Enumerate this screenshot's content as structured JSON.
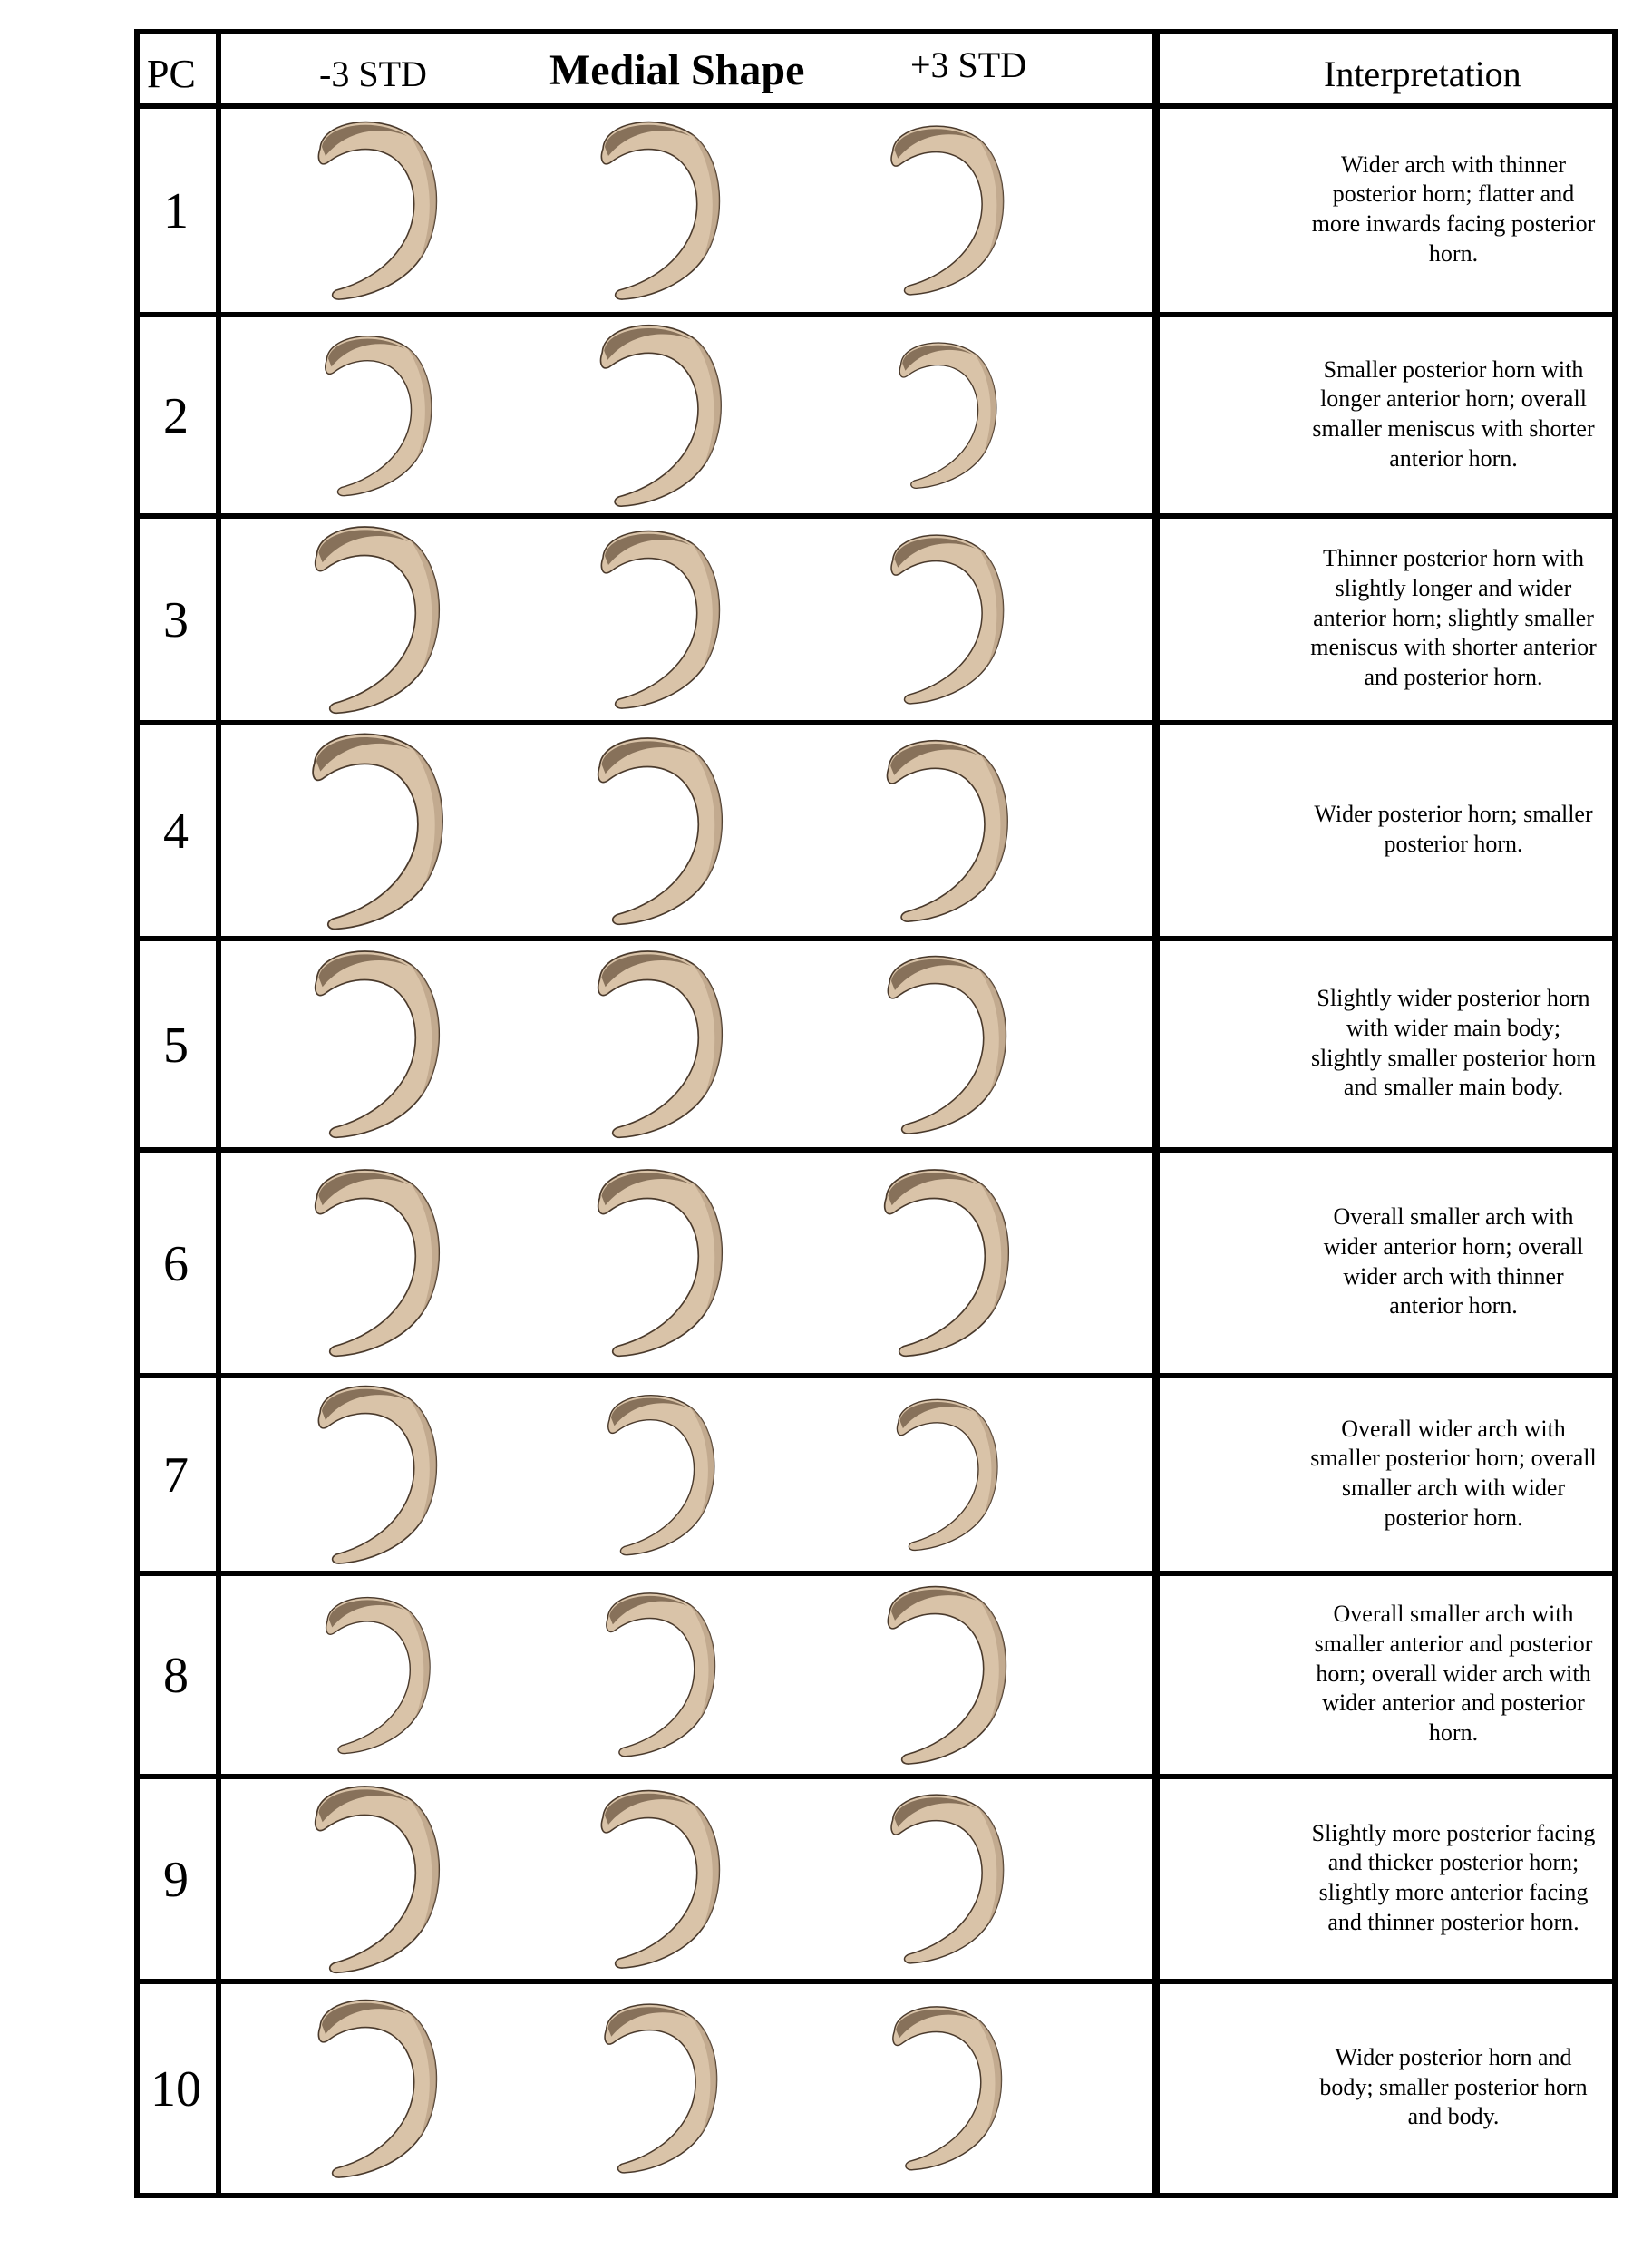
{
  "header": {
    "pc_label": "PC",
    "minus_label": "-3 STD",
    "title": "Medial Shape",
    "plus_label": "+3 STD",
    "interp_label": "Interpretation"
  },
  "shape_icon": "meniscus-shape",
  "colors": {
    "shape_fill": "#d9c3a8",
    "shape_edge": "#4a3a2c",
    "grid": "#000000"
  },
  "rows": [
    {
      "pc": "1",
      "interpretation": "Wider arch with thinner posterior horn; flatter and more inwards facing posterior horn."
    },
    {
      "pc": "2",
      "interpretation": "Smaller posterior horn with longer anterior horn; overall smaller meniscus with shorter anterior horn."
    },
    {
      "pc": "3",
      "interpretation": "Thinner posterior horn with slightly longer and wider anterior horn; slightly smaller meniscus with shorter anterior and posterior horn."
    },
    {
      "pc": "4",
      "interpretation": "Wider posterior horn; smaller posterior horn."
    },
    {
      "pc": "5",
      "interpretation": "Slightly wider posterior horn with wider main body; slightly smaller posterior horn and smaller main body."
    },
    {
      "pc": "6",
      "interpretation": "Overall smaller arch with wider anterior horn; overall wider arch with thinner anterior horn."
    },
    {
      "pc": "7",
      "interpretation": "Overall wider arch with smaller posterior horn; overall smaller arch with wider posterior horn."
    },
    {
      "pc": "8",
      "interpretation": "Overall smaller arch with smaller anterior and posterior horn; overall wider arch with wider anterior and posterior horn."
    },
    {
      "pc": "9",
      "interpretation": "Slightly more posterior facing and thicker posterior horn; slightly more anterior facing and thinner posterior horn."
    },
    {
      "pc": "10",
      "interpretation": "Wider posterior horn and body; smaller posterior horn and body."
    }
  ]
}
